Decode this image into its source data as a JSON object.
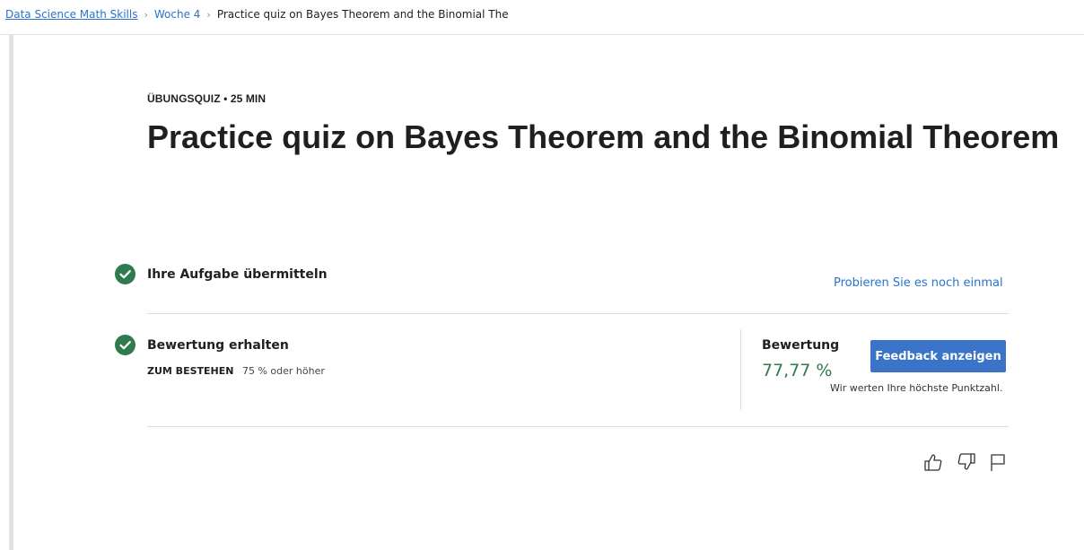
{
  "breadcrumb": {
    "course": "Data Science Math Skills",
    "week": "Woche 4",
    "current": "Practice quiz on Bayes Theorem and the Binomial The"
  },
  "quiz": {
    "eyebrow": "ÜBUNGSQUIZ • 25 MIN",
    "title": "Practice quiz on Bayes Theorem and the Binomial Theorem"
  },
  "steps": {
    "submit_label": "Ihre Aufgabe übermitteln",
    "retry_label": "Probieren Sie es noch einmal",
    "grade_received_label": "Bewertung erhalten",
    "pass_key": "ZUM BESTEHEN",
    "pass_value": "75 % oder höher"
  },
  "grade": {
    "label": "Bewertung",
    "value": "77,77 %",
    "feedback_button": "Feedback anzeigen",
    "note": "Wir werten Ihre höchste Punktzahl."
  },
  "icons": [
    "like-icon",
    "dislike-icon",
    "flag-icon"
  ],
  "colors": {
    "accent": "#3a73c8",
    "success": "#2f7a4f",
    "link": "#2a73cc"
  }
}
